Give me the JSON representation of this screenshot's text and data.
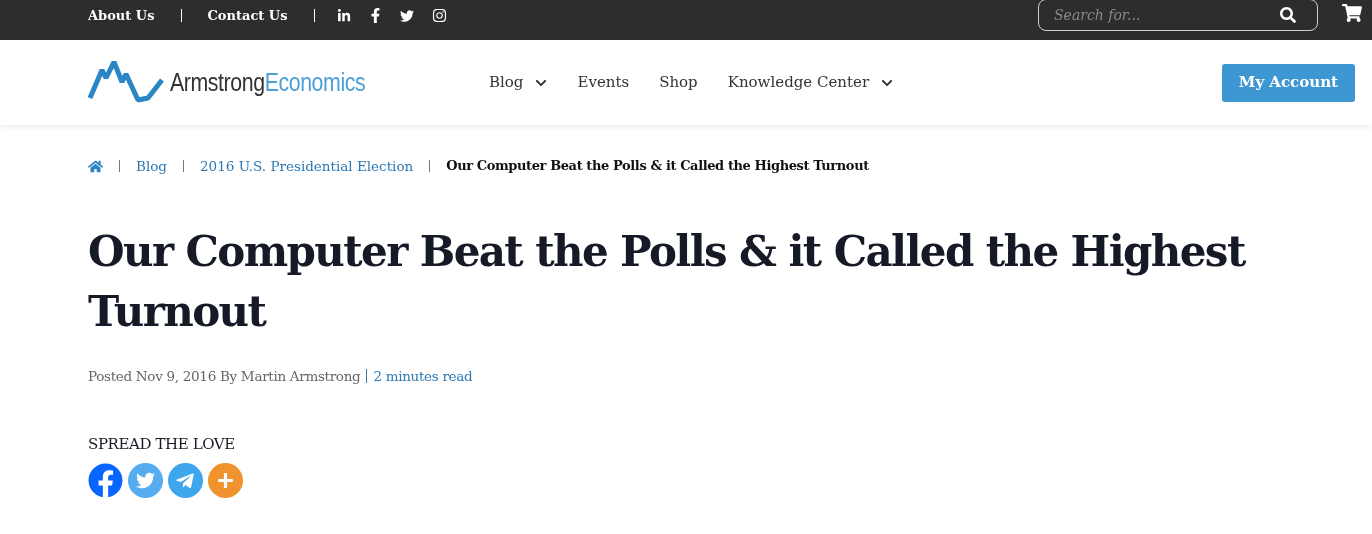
{
  "top_bar": {
    "links": [
      "About Us",
      "Contact Us"
    ],
    "social": [
      {
        "kind": "linkedin"
      },
      {
        "kind": "facebook"
      },
      {
        "kind": "twitter"
      },
      {
        "kind": "instagram"
      }
    ],
    "search": {
      "placeholder": "Search for..."
    }
  },
  "header": {
    "logo": {
      "part_1": "Armstrong",
      "part_2": "Economics"
    },
    "nav": [
      {
        "label": "Blog",
        "has_dropdown": true
      },
      {
        "label": "Events",
        "has_dropdown": false
      },
      {
        "label": "Shop",
        "has_dropdown": false
      },
      {
        "label": "Knowledge Center",
        "has_dropdown": true
      }
    ],
    "account_button": "My Account"
  },
  "breadcrumb": [
    {
      "label": "Blog",
      "current": false
    },
    {
      "label": "2016 U.S. Presidential Election",
      "current": false
    },
    {
      "label": "Our Computer Beat the Polls & it Called the Highest Turnout",
      "current": true
    }
  ],
  "article": {
    "title": "Our Computer Beat the Polls & it Called the Highest Turnout",
    "meta": "Posted Nov 9, 2016 By Martin Armstrong",
    "read_time": "2 minutes read",
    "share_heading": "SPREAD THE LOVE",
    "share_buttons": [
      {
        "kind": "facebook"
      },
      {
        "kind": "twitter"
      },
      {
        "kind": "telegram"
      },
      {
        "kind": "more"
      }
    ]
  }
}
